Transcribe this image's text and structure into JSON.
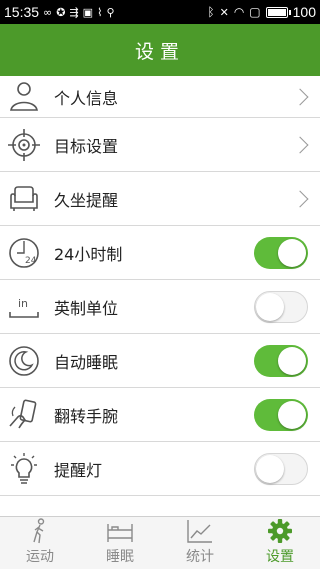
{
  "status_bar": {
    "time": "15:35",
    "battery": "100",
    "battery_level": 1.0
  },
  "header": {
    "title": "设置"
  },
  "settings": [
    {
      "label": "个人信息",
      "icon": "person-icon",
      "control": "chevron"
    },
    {
      "label": "目标设置",
      "icon": "target-icon",
      "control": "chevron"
    },
    {
      "label": "久坐提醒",
      "icon": "armchair-icon",
      "control": "chevron"
    },
    {
      "label": "24小时制",
      "icon": "clock-24-icon",
      "control": "toggle",
      "on": true
    },
    {
      "label": "英制单位",
      "icon": "ruler-inch-icon",
      "control": "toggle",
      "on": false
    },
    {
      "label": "自动睡眠",
      "icon": "moon-icon",
      "control": "toggle",
      "on": true
    },
    {
      "label": "翻转手腕",
      "icon": "wrist-flip-icon",
      "control": "toggle",
      "on": true
    },
    {
      "label": "提醒灯",
      "icon": "lightbulb-icon",
      "control": "toggle",
      "on": false
    }
  ],
  "tabs": [
    {
      "label": "运动",
      "icon": "walking-icon",
      "active": false
    },
    {
      "label": "睡眠",
      "icon": "bed-icon",
      "active": false
    },
    {
      "label": "统计",
      "icon": "chart-icon",
      "active": false
    },
    {
      "label": "设置",
      "icon": "gear-icon",
      "active": true
    }
  ],
  "colors": {
    "accent": "#4c9a2a",
    "toggle_on": "#5fbb3a",
    "tab_inactive": "#8a8a8a"
  }
}
